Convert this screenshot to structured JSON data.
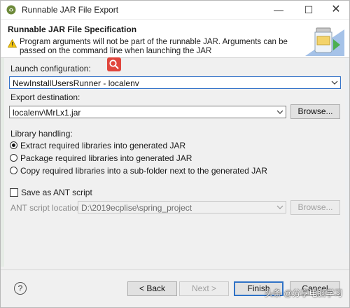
{
  "window": {
    "title": "Runnable JAR File Export",
    "icon": "eclipse-export-icon"
  },
  "banner": {
    "title": "Runnable JAR File Specification",
    "message": "Program arguments will not be part of the runnable JAR. Arguments can be passed on the command line when launching the JAR"
  },
  "launch": {
    "label": "Launch configuration:",
    "value": "NewInstallUsersRunner - localenv"
  },
  "export": {
    "label": "Export destination:",
    "value": "localenv\\MrLx1.jar",
    "browse_label": "Browse..."
  },
  "library": {
    "label": "Library handling:",
    "options": [
      {
        "label": "Extract required libraries into generated JAR",
        "checked": true
      },
      {
        "label": "Package required libraries into generated JAR",
        "checked": false
      },
      {
        "label": "Copy required libraries into a sub-folder next to the generated JAR",
        "checked": false
      }
    ]
  },
  "ant": {
    "checkbox_label": "Save as ANT script",
    "checked": false,
    "location_label": "ANT script location:",
    "location_value": "D:\\2019ecplise\\spring_project",
    "browse_label": "Browse..."
  },
  "buttons": {
    "back": "< Back",
    "next": "Next >",
    "finish": "Finish",
    "cancel": "Cancel"
  },
  "watermark": "头条 @分享电脑学习",
  "colors": {
    "accent": "#2f72c6",
    "badge": "#e0463d",
    "warning": "#f1c40f"
  }
}
